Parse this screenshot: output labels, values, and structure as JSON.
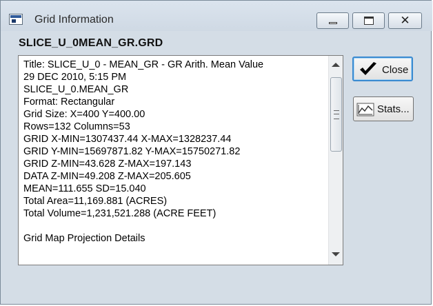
{
  "window": {
    "title": "Grid Information",
    "controls": {
      "minimize": "",
      "maximize": "",
      "close": "✕"
    }
  },
  "filename": "SLICE_U_0MEAN_GR.GRD",
  "info_lines": [
    "Title: SLICE_U_0 - MEAN_GR - GR Arith. Mean Value",
    "29 DEC 2010, 5:15 PM",
    "SLICE_U_0.MEAN_GR",
    "Format: Rectangular",
    "Grid Size: X=400 Y=400.00",
    "Rows=132 Columns=53",
    "GRID X-MIN=1307437.44 X-MAX=1328237.44",
    "GRID Y-MIN=15697871.82 Y-MAX=15750271.82",
    "GRID Z-MIN=43.628 Z-MAX=197.143",
    "DATA Z-MIN=49.208 Z-MAX=205.605",
    "MEAN=111.655 SD=15.040",
    "Total Area=11,169.881 (ACRES)",
    "Total Volume=1,231,521.288 (ACRE FEET)",
    "",
    "Grid Map Projection Details"
  ],
  "buttons": {
    "close_label": "Close",
    "stats_label": "Stats..."
  },
  "icons": {
    "app": "app-window-icon",
    "check": "check-icon",
    "stats": "stats-chart-icon"
  },
  "colors": {
    "check": "#000000",
    "focus_border": "#3a8ad0",
    "window_bg": "#d4dde6"
  }
}
